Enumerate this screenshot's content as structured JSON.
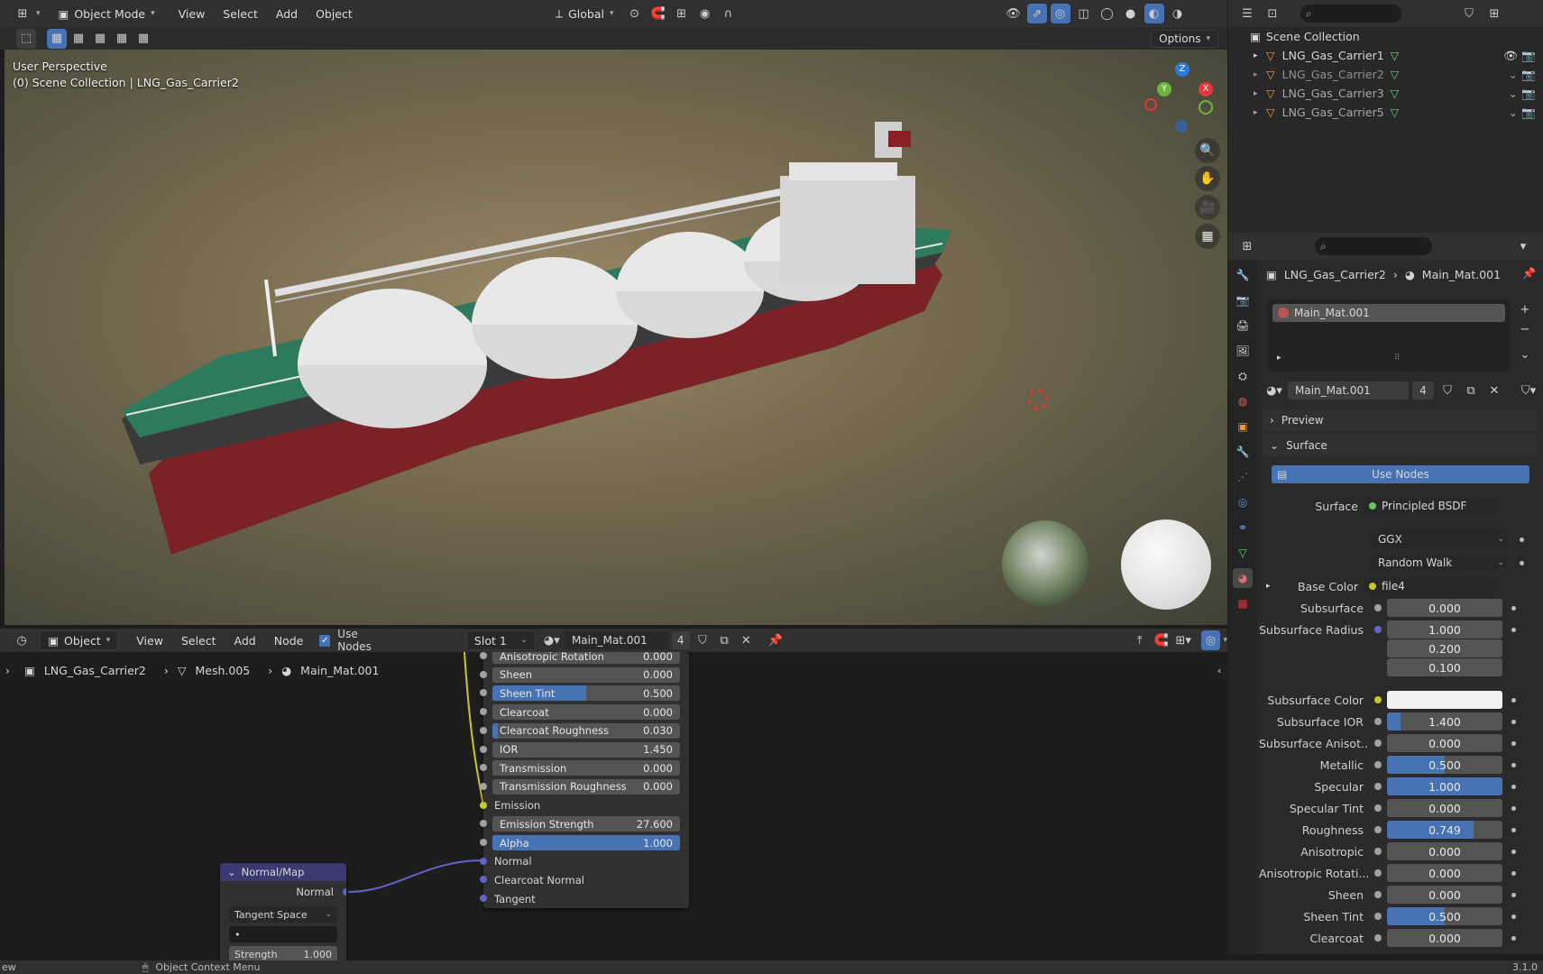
{
  "top_header": {
    "mode": "Object Mode",
    "menus": [
      "View",
      "Select",
      "Add",
      "Object"
    ],
    "transform_orientation": "Global",
    "options_label": "Options"
  },
  "viewport": {
    "perspective": "User Perspective",
    "collection_info": "(0) Scene Collection | LNG_Gas_Carrier2",
    "gizmo_axes": [
      "X",
      "Y",
      "Z"
    ]
  },
  "outliner": {
    "root": "Scene Collection",
    "items": [
      "LNG_Gas_Carrier1",
      "LNG_Gas_Carrier2",
      "LNG_Gas_Carrier3",
      "LNG_Gas_Carrier5"
    ]
  },
  "properties": {
    "breadcrumb_object": "LNG_Gas_Carrier2",
    "breadcrumb_material": "Main_Mat.001",
    "slot_name": "Main_Mat.001",
    "material_name": "Main_Mat.001",
    "users": "4",
    "preview_label": "Preview",
    "surface_label": "Surface",
    "use_nodes_label": "Use Nodes",
    "surface_field_label": "Surface",
    "surface_shader": "Principled BSDF",
    "distribution": "GGX",
    "subsurface_method": "Random Walk",
    "base_color_label": "Base Color",
    "base_color_value": "file4",
    "rows": [
      {
        "label": "Subsurface",
        "value": "0.000",
        "fill": 0
      },
      {
        "label": "Subsurface Radius",
        "value": "1.000",
        "fill": 0
      },
      {
        "label": "",
        "value": "0.200",
        "fill": 0
      },
      {
        "label": "",
        "value": "0.100",
        "fill": 0
      },
      {
        "label": "Subsurface Color",
        "value": "",
        "fill": 0
      },
      {
        "label": "Subsurface IOR",
        "value": "1.400",
        "fill": 0.12
      },
      {
        "label": "Subsurface Anisot...",
        "value": "0.000",
        "fill": 0
      },
      {
        "label": "Metallic",
        "value": "0.500",
        "fill": 0.5
      },
      {
        "label": "Specular",
        "value": "1.000",
        "fill": 1.0
      },
      {
        "label": "Specular Tint",
        "value": "0.000",
        "fill": 0
      },
      {
        "label": "Roughness",
        "value": "0.749",
        "fill": 0.749
      },
      {
        "label": "Anisotropic",
        "value": "0.000",
        "fill": 0
      },
      {
        "label": "Anisotropic Rotati...",
        "value": "0.000",
        "fill": 0
      },
      {
        "label": "Sheen",
        "value": "0.000",
        "fill": 0
      },
      {
        "label": "Sheen Tint",
        "value": "0.500",
        "fill": 0.5
      },
      {
        "label": "Clearcoat",
        "value": "0.000",
        "fill": 0
      }
    ]
  },
  "node_header": {
    "editor_type": "Object",
    "menus": [
      "View",
      "Select",
      "Add",
      "Node"
    ],
    "use_nodes": "Use Nodes",
    "slot": "Slot 1",
    "material": "Main_Mat.001",
    "users": "4"
  },
  "node_breadcrumb": {
    "object": "LNG_Gas_Carrier2",
    "mesh": "Mesh.005",
    "material": "Main_Mat.001"
  },
  "bsdf_node": {
    "rows": [
      {
        "label": "Anisotropic Rotation",
        "value": "0.000",
        "fill": 0,
        "type": "field"
      },
      {
        "label": "Sheen",
        "value": "0.000",
        "fill": 0,
        "type": "field"
      },
      {
        "label": "Sheen Tint",
        "value": "0.500",
        "fill": 0.5,
        "type": "field"
      },
      {
        "label": "Clearcoat",
        "value": "0.000",
        "fill": 0,
        "type": "field"
      },
      {
        "label": "Clearcoat Roughness",
        "value": "0.030",
        "fill": 0.03,
        "type": "field"
      },
      {
        "label": "IOR",
        "value": "1.450",
        "fill": 0,
        "type": "field"
      },
      {
        "label": "Transmission",
        "value": "0.000",
        "fill": 0,
        "type": "field"
      },
      {
        "label": "Transmission Roughness",
        "value": "0.000",
        "fill": 0,
        "type": "field"
      },
      {
        "label": "Emission",
        "value": "",
        "fill": 0,
        "type": "socket"
      },
      {
        "label": "Emission Strength",
        "value": "27.600",
        "fill": 0,
        "type": "field"
      },
      {
        "label": "Alpha",
        "value": "1.000",
        "fill": 1,
        "type": "field"
      },
      {
        "label": "Normal",
        "value": "",
        "fill": 0,
        "type": "socket"
      },
      {
        "label": "Clearcoat Normal",
        "value": "",
        "fill": 0,
        "type": "socket"
      },
      {
        "label": "Tangent",
        "value": "",
        "fill": 0,
        "type": "socket"
      }
    ]
  },
  "normal_map_node": {
    "title": "Normal/Map",
    "output": "Normal",
    "space": "Tangent Space",
    "uv": "•",
    "strength_label": "Strength",
    "strength": "1.000"
  },
  "statusbar": {
    "left": "ew",
    "context": "Object Context Menu",
    "version": "3.1.0"
  }
}
